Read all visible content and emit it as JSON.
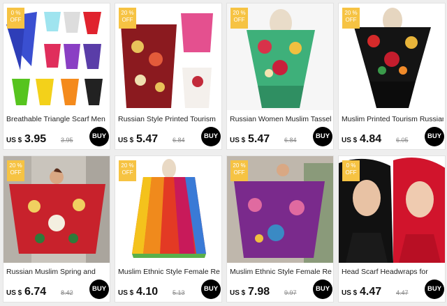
{
  "colors": {
    "badge": "#f6c343",
    "buy_button": "#000000",
    "page_bg": "#eeeeee"
  },
  "products": [
    {
      "badge_pct": "0 %",
      "badge_off": "OFF",
      "title": "Breathable Triangle Scarf Men",
      "currency": "US $",
      "price": "3.95",
      "old_price": "3.95",
      "buy_label": "BUY",
      "image": "triangle-scarves-grid-image"
    },
    {
      "badge_pct": "20 %",
      "badge_off": "OFF",
      "title": "Russian Style Printed Tourism",
      "currency": "US $",
      "price": "5.47",
      "old_price": "6.84",
      "buy_label": "BUY",
      "image": "red-floral-shawl-image"
    },
    {
      "badge_pct": "20 %",
      "badge_off": "OFF",
      "title": "Russian Women Muslim Tassel",
      "currency": "US $",
      "price": "5.47",
      "old_price": "6.84",
      "buy_label": "BUY",
      "image": "green-floral-shawl-image"
    },
    {
      "badge_pct": "20 %",
      "badge_off": "OFF",
      "title": "Muslim Printed Tourism Russian",
      "currency": "US $",
      "price": "4.84",
      "old_price": "6.05",
      "buy_label": "BUY",
      "image": "black-floral-shawl-image"
    },
    {
      "badge_pct": "20 %",
      "badge_off": "OFF",
      "title": "Russian Muslim Spring and",
      "currency": "US $",
      "price": "6.74",
      "old_price": "8.42",
      "buy_label": "BUY",
      "image": "woman-red-shawl-image"
    },
    {
      "badge_pct": "20 %",
      "badge_off": "OFF",
      "title": "Muslim Ethnic Style Female Retro",
      "currency": "US $",
      "price": "4.10",
      "old_price": "5.13",
      "buy_label": "BUY",
      "image": "rainbow-scarf-image"
    },
    {
      "badge_pct": "20 %",
      "badge_off": "OFF",
      "title": "Muslim Ethnic Style Female Retro",
      "currency": "US $",
      "price": "7.98",
      "old_price": "9.97",
      "buy_label": "BUY",
      "image": "purple-pashmina-image"
    },
    {
      "badge_pct": "0 %",
      "badge_off": "OFF",
      "title": "Head Scarf Headwraps for",
      "currency": "US $",
      "price": "4.47",
      "old_price": "4.47",
      "buy_label": "BUY",
      "image": "head-scarf-models-image"
    }
  ]
}
